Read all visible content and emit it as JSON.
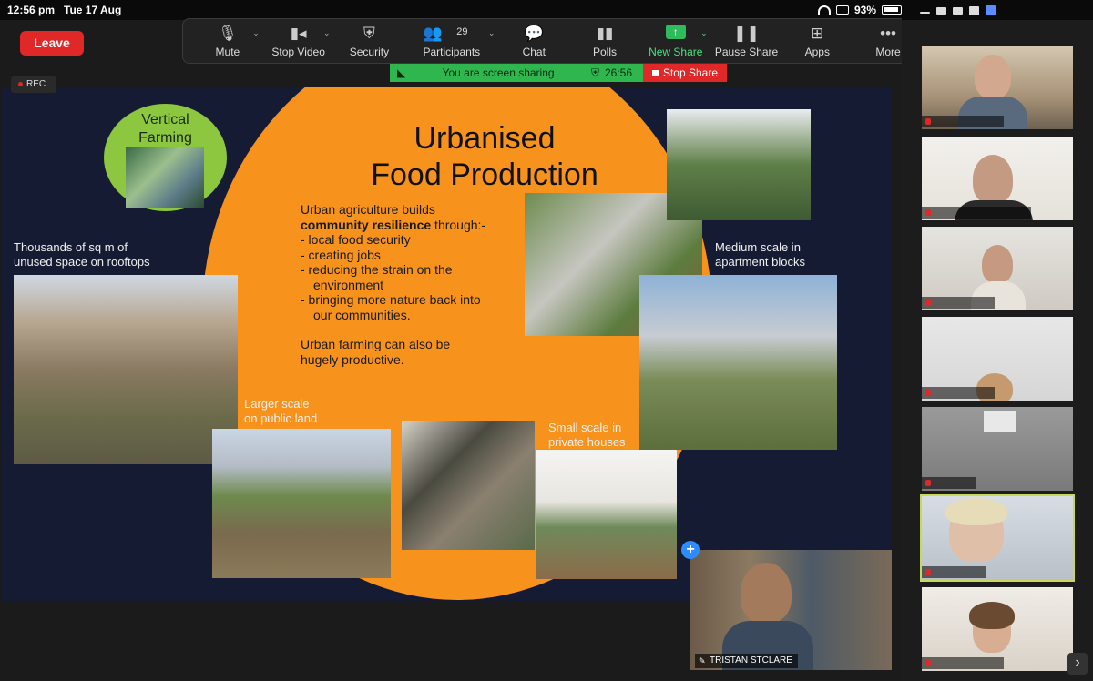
{
  "status_bar": {
    "time": "12:56 pm",
    "date": "Tue 17 Aug",
    "battery": "93%"
  },
  "meeting": {
    "leave_label": "Leave",
    "rec_label": "REC",
    "toolbar": {
      "mute": "Mute",
      "stop_video": "Stop Video",
      "security": "Security",
      "participants": "Participants",
      "participants_count": "29",
      "chat": "Chat",
      "polls": "Polls",
      "new_share": "New Share",
      "pause_share": "Pause Share",
      "apps": "Apps",
      "more": "More"
    },
    "share_bar": {
      "message": "You are screen sharing",
      "timer": "26:56",
      "stop_label": "Stop Share"
    },
    "colors": {
      "leave": "#e02828",
      "share_green": "#2fb64f",
      "new_share_green": "#2dbb5b",
      "slide_bg": "#151b33",
      "slide_orange": "#f7921d",
      "vertical_farming_green": "#8dc63f"
    }
  },
  "slide": {
    "title_line1": "Urbanised",
    "title_line2": "Food Production",
    "vertical_farming": "Vertical Farming",
    "body": {
      "intro": "Urban agriculture builds",
      "intro_bold": "community resilience",
      "intro_tail": " through:-",
      "bullets": [
        "- local food security",
        "- creating jobs",
        "- reducing the strain on the",
        "environment",
        "- bringing more nature back into",
        "our communities."
      ],
      "closing_line1": "Urban farming can also be",
      "closing_line2": "hugely productive."
    },
    "captions": {
      "rooftops_line1": "Thousands of sq m of",
      "rooftops_line2": "unused space on rooftops",
      "public_line1": "Larger scale",
      "public_line2": "on public land",
      "private_line1": "Small scale in",
      "private_line2": "private houses",
      "apartment_line1": "Medium scale in",
      "apartment_line2": "apartment blocks"
    }
  },
  "presenter": {
    "name": "TRISTAN STCLARE"
  },
  "gallery": {
    "participants": [
      {
        "label": ""
      },
      {
        "label": ""
      },
      {
        "label": ""
      },
      {
        "label": ""
      },
      {
        "label": ""
      },
      {
        "label": ""
      },
      {
        "label": ""
      }
    ]
  }
}
